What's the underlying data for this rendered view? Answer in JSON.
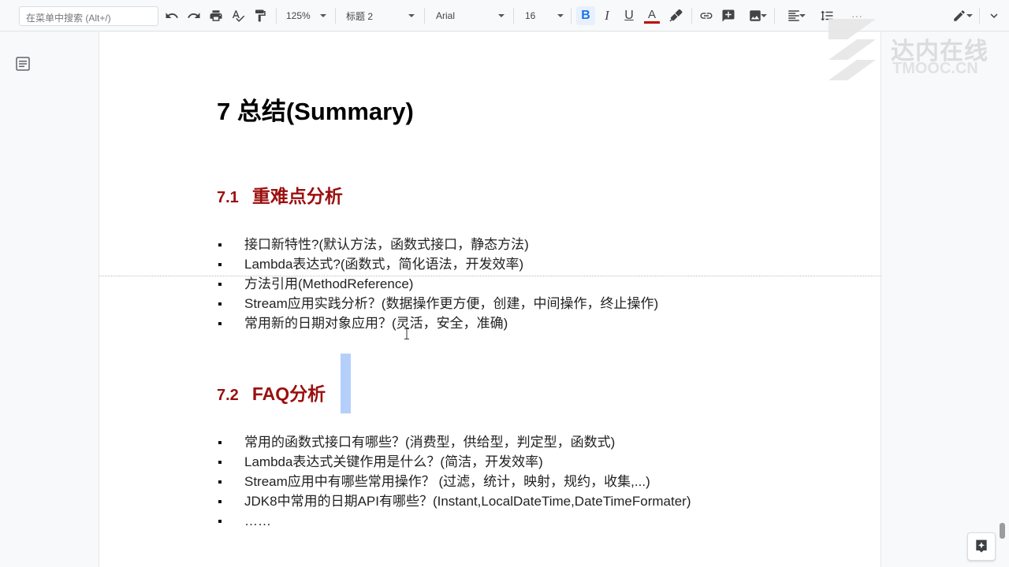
{
  "toolbar": {
    "search_placeholder": "在菜单中搜索 (Alt+/)",
    "zoom": "125%",
    "style": "标题 2",
    "font": "Arial",
    "font_size": "16",
    "bold": "B",
    "italic": "I",
    "underline": "U",
    "text_color": "A",
    "more": "···",
    "text_color_value": "#c00000"
  },
  "doc": {
    "title": "7  总结(Summary)",
    "sections": [
      {
        "number": "7.1",
        "heading": "重难点分析",
        "items": [
          "接口新特性?(默认方法，函数式接口，静态方法)",
          "Lambda表达式?(函数式，简化语法，开发效率)",
          "方法引用(MethodReference)",
          "Stream应用实践分析？(数据操作更方便，创建，中间操作，终止操作)",
          "常用新的日期对象应用？(灵活，安全，准确)"
        ]
      },
      {
        "number": "7.2",
        "heading": "FAQ分析",
        "items": [
          "常用的函数式接口有哪些？(消费型，供给型，判定型，函数式)",
          "Lambda表达式关键作用是什么？(简洁，开发效率)",
          "Stream应用中有哪些常用操作？ (过滤，统计，映射，规约，收集,...)",
          "JDK8中常用的日期API有哪些？(Instant,LocalDateTime,DateTimeFormater)",
          "……"
        ]
      }
    ]
  },
  "watermark": {
    "line1": "达内在线",
    "line2": "TMOOC.CN"
  },
  "colors": {
    "heading2": "#9b0f0f",
    "selection": "#a8c7fa",
    "bold_active_bg": "#e8f0fe"
  }
}
